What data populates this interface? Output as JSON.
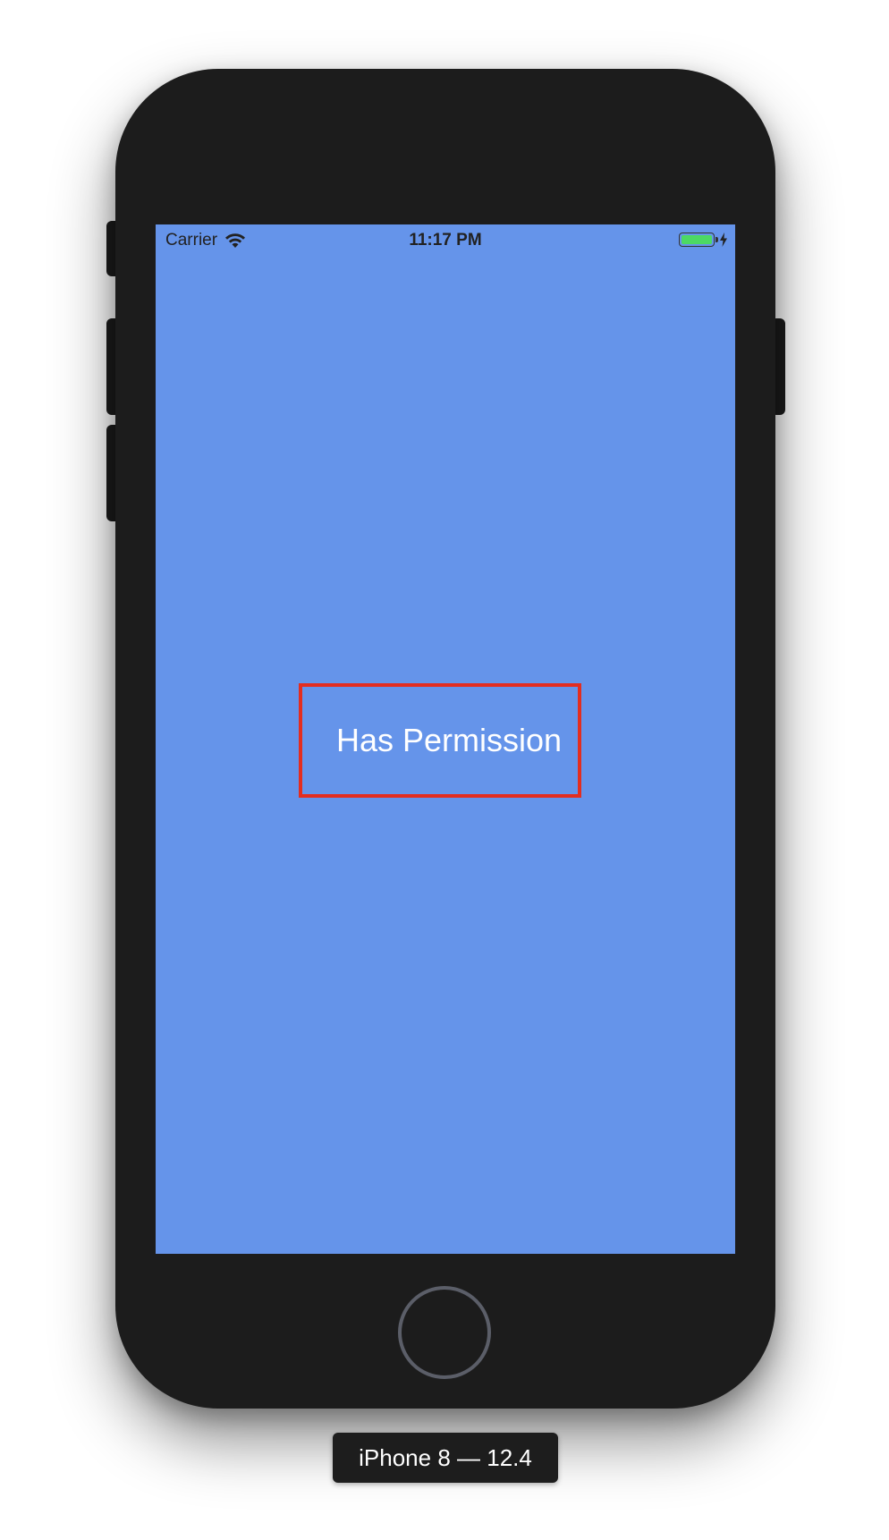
{
  "status_bar": {
    "carrier": "Carrier",
    "time": "11:17 PM",
    "wifi_icon": "wifi-icon",
    "battery_icon": "battery-charging-icon",
    "battery_level": 1.0
  },
  "screen": {
    "background_color": "#6594ea",
    "permission_label": "Has Permission",
    "highlight_color": "#e32d20"
  },
  "device": {
    "label": "iPhone 8 — 12.4",
    "home_button_icon": "home-button-icon"
  }
}
